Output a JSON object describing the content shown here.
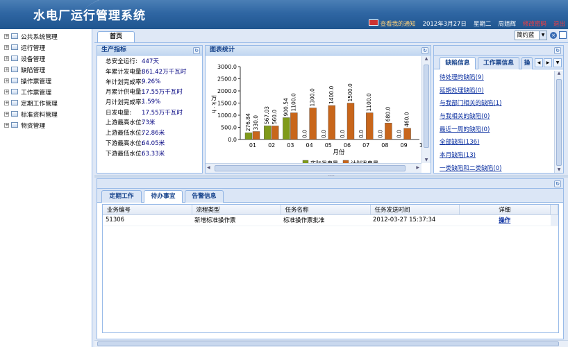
{
  "header": {
    "title": "水电厂运行管理系统",
    "notice": "查看我的通知",
    "date": "2012年3月27日",
    "weekday": "星期二",
    "user": "周姐辉",
    "logout_a": "修改密码",
    "logout_b": "退出",
    "colors": {
      "header_bg": "#2f66a3",
      "accent_red": "#ff3b3b"
    }
  },
  "sidebar": {
    "items": [
      {
        "label": "公共系统管理"
      },
      {
        "label": "运行管理"
      },
      {
        "label": "设备管理"
      },
      {
        "label": "缺陷管理"
      },
      {
        "label": "操作票管理"
      },
      {
        "label": "工作票管理"
      },
      {
        "label": "定期工作管理"
      },
      {
        "label": "标准资料管理"
      },
      {
        "label": "物资管理"
      }
    ]
  },
  "tabs": {
    "home": "首页",
    "theme": "简约蓝"
  },
  "production": {
    "title": "生产指标",
    "rows": [
      {
        "k": "总安全运行:",
        "v": "447天"
      },
      {
        "k": "年累计发电量:",
        "v": "861.42万千瓦时"
      },
      {
        "k": "年计划完成率:",
        "v": "9.26%"
      },
      {
        "k": "月累计供电量:",
        "v": "17.55万千瓦时"
      },
      {
        "k": "月计划完成率:",
        "v": "1.59%"
      },
      {
        "k": "日发电量:",
        "v": "17.55万千瓦时"
      },
      {
        "k": "上游最高水位:",
        "v": "73米"
      },
      {
        "k": "上游最低水位:",
        "v": "72.86米"
      },
      {
        "k": "下游最高水位:",
        "v": "64.05米"
      },
      {
        "k": "下游最低水位:",
        "v": "63.33米"
      }
    ]
  },
  "chart_panel": {
    "title": "图表统计"
  },
  "chart_data": {
    "type": "bar",
    "categories": [
      "01",
      "02",
      "03",
      "04",
      "05",
      "06",
      "07",
      "08",
      "09",
      "10"
    ],
    "series": [
      {
        "name": "实际发电量",
        "color": "#7f9a1a",
        "values": [
          276.84,
          567.03,
          900.54,
          0,
          0,
          0,
          0,
          0,
          0,
          0
        ]
      },
      {
        "name": "计划发电量",
        "color": "#c8661b",
        "values": [
          330.0,
          560.0,
          1100.0,
          1300.0,
          1400.0,
          1500.0,
          1100.0,
          680.0,
          460.0,
          0
        ]
      }
    ],
    "value_labels": [
      [
        "276.84",
        "567.03",
        "900.54",
        "0.0",
        "0.0",
        "0.0",
        "0.0",
        "0.0",
        "0.0",
        ""
      ],
      [
        "330.0",
        "560.0",
        "1100.0",
        "1300.0",
        "1400.0",
        "1500.0",
        "1100.0",
        "680.0",
        "460.0",
        ""
      ]
    ],
    "y_ticks": [
      "0.0",
      "500.0",
      "1000.0",
      "1500.0",
      "2000.0",
      "2500.0",
      "3000.0"
    ],
    "ylim": [
      0,
      3000
    ],
    "xlabel": "月份",
    "ylabel": "万k·h",
    "grid": false,
    "legend_placement": "bottom"
  },
  "defects": {
    "tabs": [
      "缺陷信息",
      "工作票信息",
      "操作"
    ],
    "links": [
      "待处理的缺陷(9)",
      "延期处理缺陷(0)",
      "与我部门相关的缺陷(1)",
      "与我相关的缺陷(0)",
      "最近一周的缺陷(0)",
      "全部缺陷(136)",
      "本月缺陷(13)",
      "一类缺陷和二类缺陷(0)"
    ]
  },
  "bottom": {
    "tabs": [
      "定期工作",
      "待办事宜",
      "告警信息"
    ],
    "columns": [
      "业务编号",
      "流程类型",
      "任务名称",
      "任务发送时间",
      "详细"
    ],
    "rows": [
      {
        "id": "51306",
        "type": "新增标准操作票",
        "name": "标准操作票批准",
        "time": "2012-03-27 15:37:34",
        "action": "操作"
      }
    ]
  }
}
